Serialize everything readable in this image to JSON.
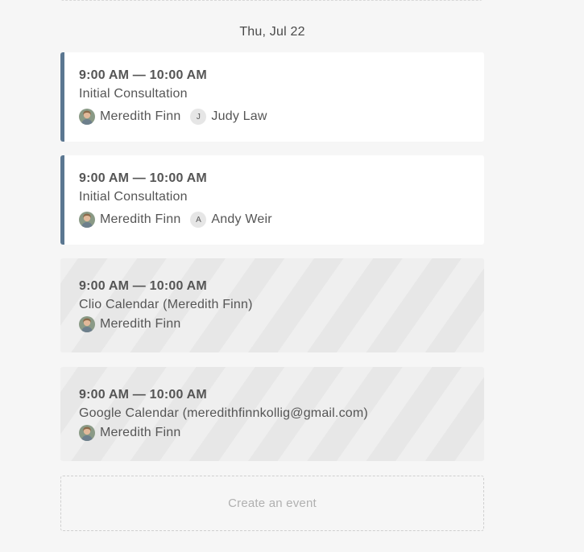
{
  "day": {
    "heading": "Thu, Jul 22"
  },
  "events": [
    {
      "time": "9:00 AM — 10:00 AM",
      "title": "Initial Consultation",
      "attendees": [
        {
          "name": "Meredith Finn",
          "avatar": "photo"
        },
        {
          "name": "Judy Law",
          "avatar": "initial",
          "initial": "J"
        }
      ]
    },
    {
      "time": "9:00 AM — 10:00 AM",
      "title": "Initial Consultation",
      "attendees": [
        {
          "name": "Meredith Finn",
          "avatar": "photo"
        },
        {
          "name": "Andy Weir",
          "avatar": "initial",
          "initial": "A"
        }
      ]
    },
    {
      "time": "9:00 AM — 10:00 AM",
      "title": "Clio Calendar (Meredith Finn)",
      "attendees": [
        {
          "name": "Meredith Finn",
          "avatar": "photo"
        }
      ]
    },
    {
      "time": "9:00 AM — 10:00 AM",
      "title": "Google Calendar (meredithfinnkollig@gmail.com)",
      "attendees": [
        {
          "name": "Meredith Finn",
          "avatar": "photo"
        }
      ]
    }
  ],
  "actions": {
    "create_event_label": "Create an event"
  },
  "colors": {
    "appointment_accent": "#5b7791",
    "background": "#f6f6f6"
  }
}
